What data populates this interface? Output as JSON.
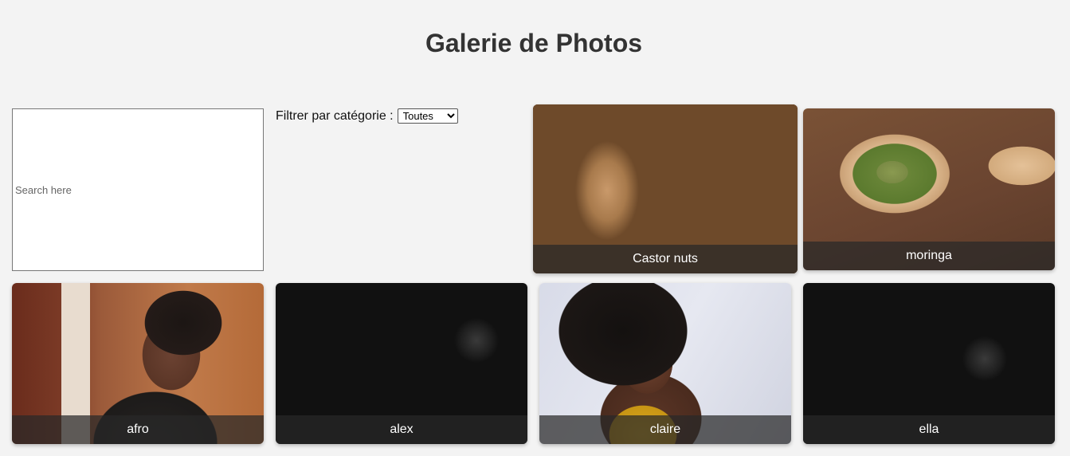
{
  "page": {
    "title": "Galerie de Photos"
  },
  "search": {
    "placeholder": "Search here"
  },
  "filter": {
    "label": "Filtrer par catégorie :",
    "selected": "Toutes"
  },
  "gallery": [
    {
      "caption": "Castor nuts"
    },
    {
      "caption": "moringa"
    },
    {
      "caption": "afro"
    },
    {
      "caption": "alex"
    },
    {
      "caption": "claire"
    },
    {
      "caption": "ella"
    }
  ]
}
